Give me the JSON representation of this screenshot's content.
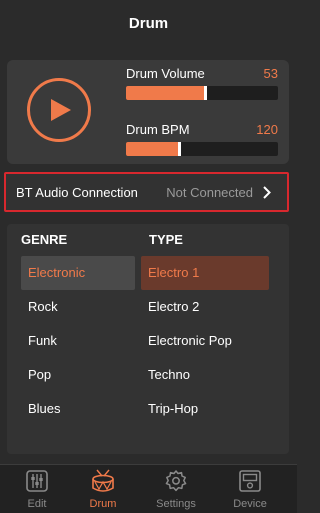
{
  "header": {
    "title": "Drum"
  },
  "player": {
    "volume": {
      "label": "Drum Volume",
      "value": "53",
      "level": 0.53
    },
    "bpm": {
      "label": "Drum BPM",
      "value": "120",
      "level": 0.36
    }
  },
  "bt": {
    "label": "BT Audio Connection",
    "status": "Not Connected"
  },
  "genre": {
    "header": "GENRE",
    "items": [
      "Electronic",
      "Rock",
      "Funk",
      "Pop",
      "Blues"
    ],
    "selected": "Electronic"
  },
  "type": {
    "header": "TYPE",
    "items": [
      "Electro 1",
      "Electro 2",
      "Electronic Pop",
      "Techno",
      "Trip-Hop"
    ],
    "selected": "Electro 1"
  },
  "tabs": [
    {
      "label": "Edit",
      "icon": "sliders-icon"
    },
    {
      "label": "Drum",
      "icon": "drum-icon",
      "active": true
    },
    {
      "label": "Settings",
      "icon": "gear-icon"
    },
    {
      "label": "Device",
      "icon": "device-icon"
    }
  ],
  "colors": {
    "accent": "#f07a4a",
    "alert_border": "#d8282e",
    "background": "#2b2b2b"
  }
}
